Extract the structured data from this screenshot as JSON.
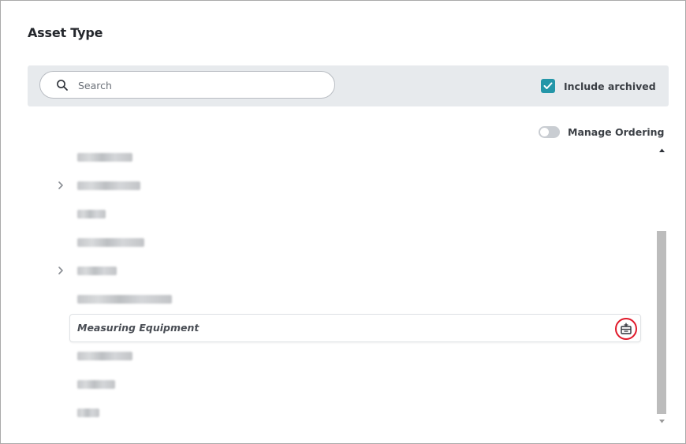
{
  "dialog": {
    "title": "Asset Type"
  },
  "toolbar": {
    "search": {
      "placeholder": "Search",
      "value": "",
      "icon": "search-icon"
    },
    "include_archived": {
      "label": "Include archived",
      "checked": true,
      "color": "#2496a8"
    }
  },
  "manage_ordering": {
    "label": "Manage Ordering",
    "enabled": false
  },
  "list": {
    "items": [
      {
        "label": "",
        "blurred": true,
        "expandable": false
      },
      {
        "label": "",
        "blurred": true,
        "expandable": true
      },
      {
        "label": "",
        "blurred": true,
        "expandable": false
      },
      {
        "label": "",
        "blurred": true,
        "expandable": false
      },
      {
        "label": "",
        "blurred": true,
        "expandable": true
      },
      {
        "label": "",
        "blurred": true,
        "expandable": false
      },
      {
        "label": "Measuring Equipment",
        "blurred": false,
        "expandable": false,
        "hovered": true,
        "action_icon": "archive-icon",
        "action_color": "#e0192a"
      },
      {
        "label": "",
        "blurred": true,
        "expandable": false
      },
      {
        "label": "",
        "blurred": true,
        "expandable": false
      },
      {
        "label": "",
        "blurred": true,
        "expandable": false
      }
    ]
  }
}
